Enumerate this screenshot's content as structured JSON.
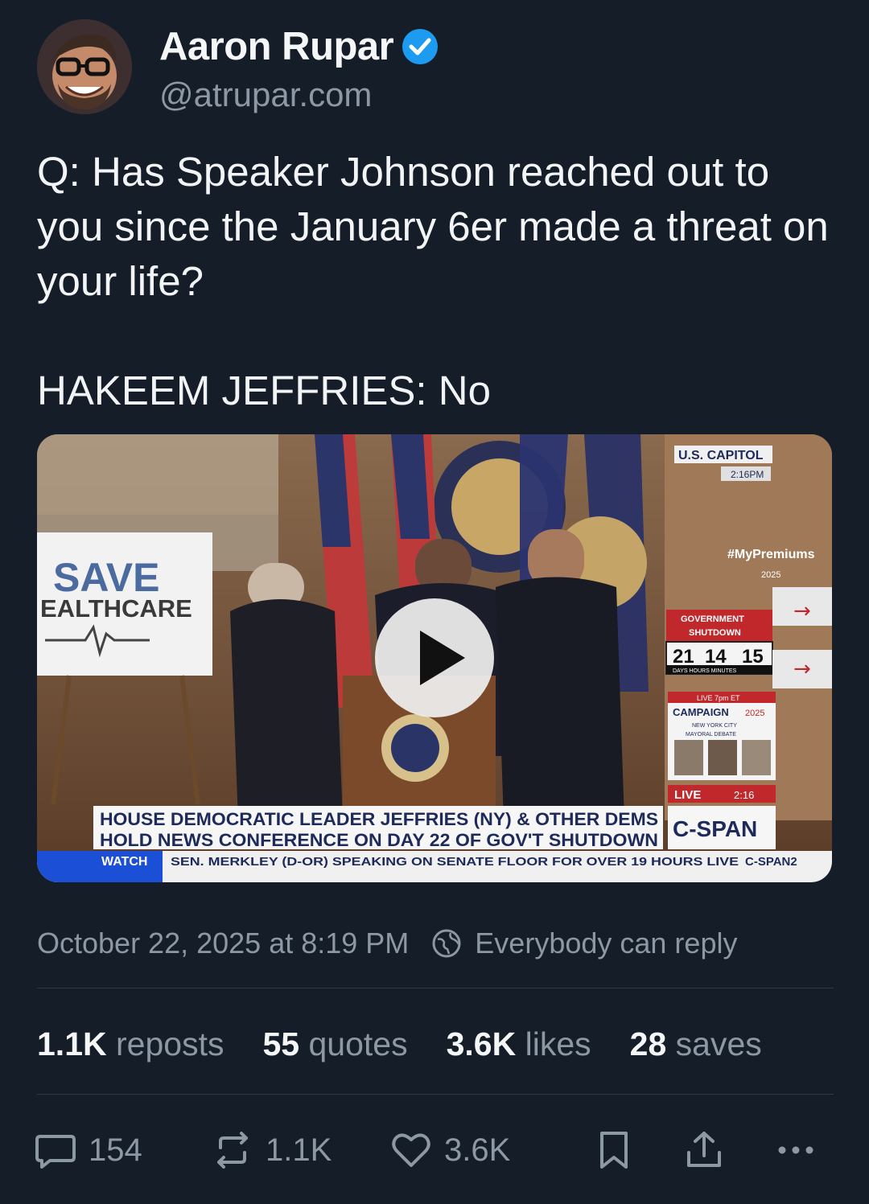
{
  "author": {
    "name": "Aaron Rupar",
    "handle": "@atrupar.com",
    "verified": true
  },
  "post": {
    "text": "Q: Has Speaker Johnson reached out to you since the January 6er made a threat on your life?",
    "answer": "HAKEEM JEFFRIES: No"
  },
  "media": {
    "type": "video",
    "sign_top": "SAVE",
    "sign_bottom": "EALTHCARE",
    "bug_location": "U.S. CAPITOL",
    "bug_time": "2:16PM",
    "promo": "#MyPremiums",
    "promo_year": "2025",
    "shutdown_title_1": "GOVERNMENT",
    "shutdown_title_2": "SHUTDOWN",
    "clock_days": "21",
    "clock_hours": "14",
    "clock_minutes": "15",
    "clock_labels": "DAYS  HOURS  MINUTES",
    "campaign_live": "LIVE 7pm ET",
    "campaign": "CAMPAIGN",
    "campaign_year": "2025",
    "campaign_sub": "NEW YORK CITY",
    "campaign_sub2": "MAYORAL DEBATE",
    "live_label": "LIVE",
    "live_time": "2:16",
    "chyron_line1": "HOUSE DEMOCRATIC LEADER JEFFRIES (NY) & OTHER DEMS",
    "chyron_line2": "HOLD NEWS CONFERENCE ON DAY 22 OF GOV'T SHUTDOWN",
    "network": "C-SPAN",
    "ticker_label": "WATCH",
    "ticker_text": "SEN. MERKLEY (D-OR) SPEAKING ON SENATE FLOOR FOR OVER 19 HOURS LIVE",
    "ticker_network": "C-SPAN2"
  },
  "meta": {
    "timestamp": "October 22, 2025 at 8:19 PM",
    "reply_setting": "Everybody can reply"
  },
  "stats": [
    {
      "value": "1.1K",
      "label": "reposts"
    },
    {
      "value": "55",
      "label": "quotes"
    },
    {
      "value": "3.6K",
      "label": "likes"
    },
    {
      "value": "28",
      "label": "saves"
    }
  ],
  "actions": {
    "replies": "154",
    "reposts": "1.1K",
    "likes": "3.6K"
  },
  "colors": {
    "background": "#151d28",
    "verified": "#1d9bf0",
    "muted": "#8d98a5"
  }
}
